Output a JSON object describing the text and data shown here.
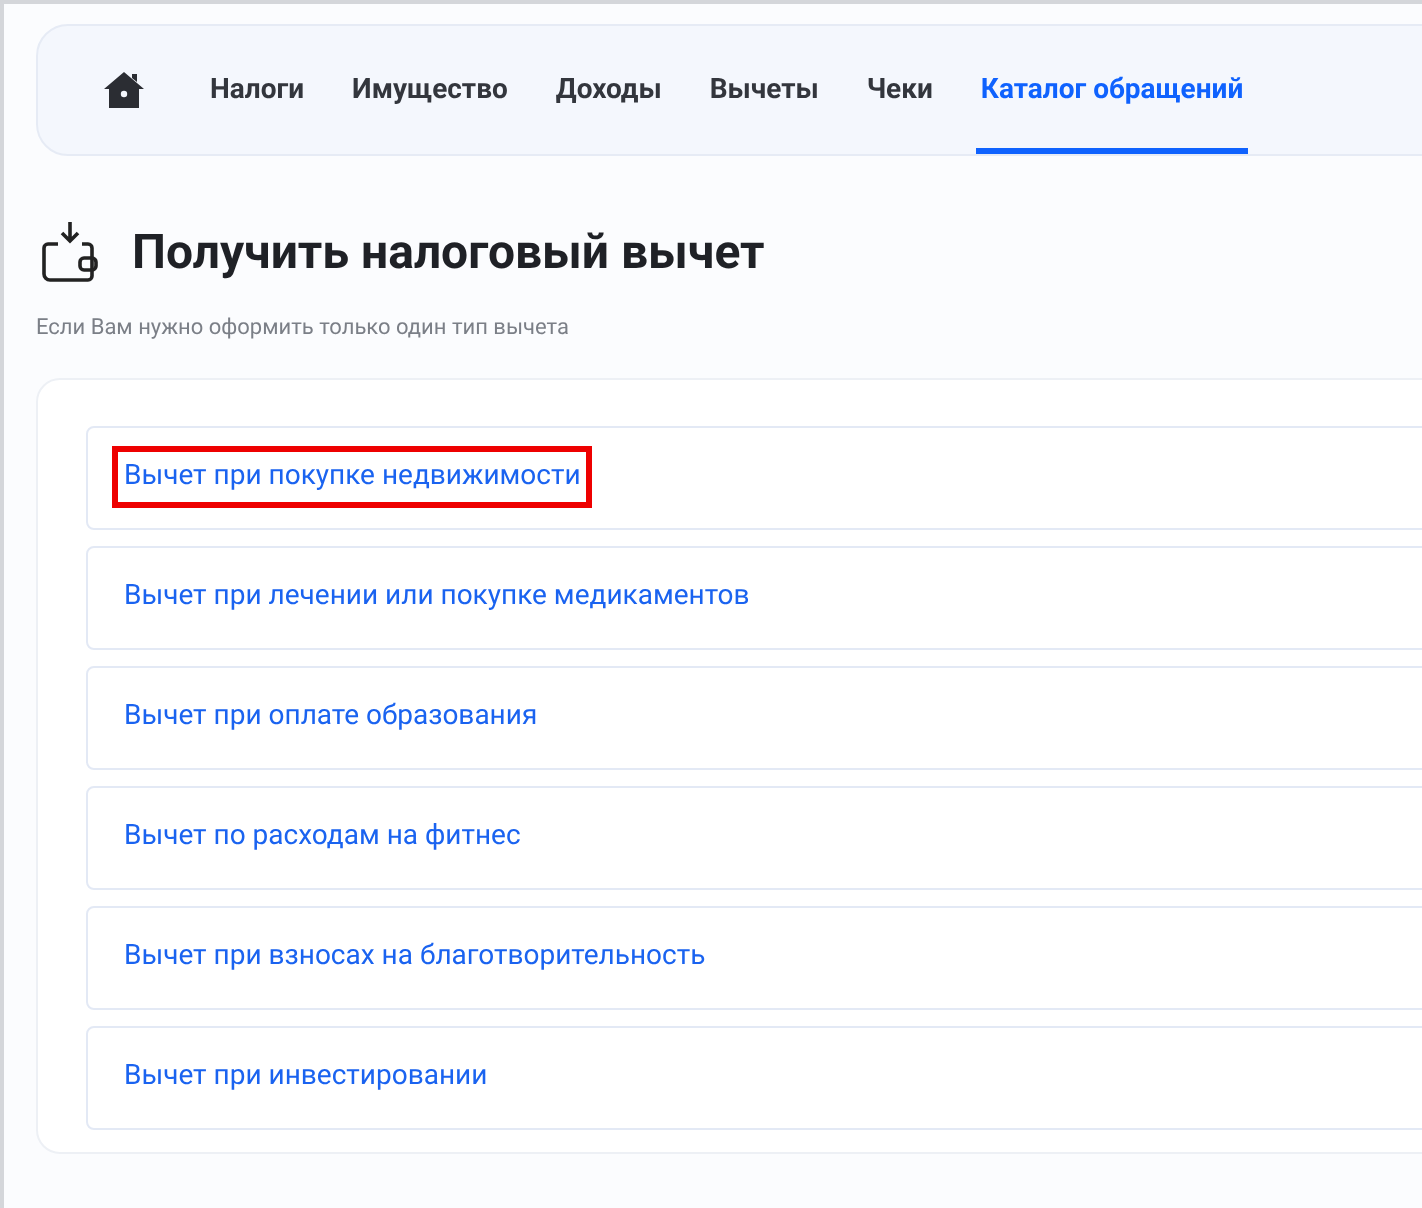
{
  "nav": {
    "tabs": [
      {
        "label": "Налоги",
        "selected": false
      },
      {
        "label": "Имущество",
        "selected": false
      },
      {
        "label": "Доходы",
        "selected": false
      },
      {
        "label": "Вычеты",
        "selected": false
      },
      {
        "label": "Чеки",
        "selected": false
      },
      {
        "label": "Каталог обращений",
        "selected": true
      }
    ]
  },
  "heading": {
    "title": "Получить налоговый вычет",
    "subtitle": "Если Вам нужно оформить только один тип вычета"
  },
  "deductions": [
    {
      "label": "Вычет при покупке недвижимости",
      "highlighted": true
    },
    {
      "label": "Вычет при лечении или покупке медикаментов",
      "highlighted": false
    },
    {
      "label": "Вычет при оплате образования",
      "highlighted": false
    },
    {
      "label": "Вычет по расходам на фитнес",
      "highlighted": false
    },
    {
      "label": "Вычет при взносах на благотворительность",
      "highlighted": false
    },
    {
      "label": "Вычет при инвестировании",
      "highlighted": false
    }
  ]
}
